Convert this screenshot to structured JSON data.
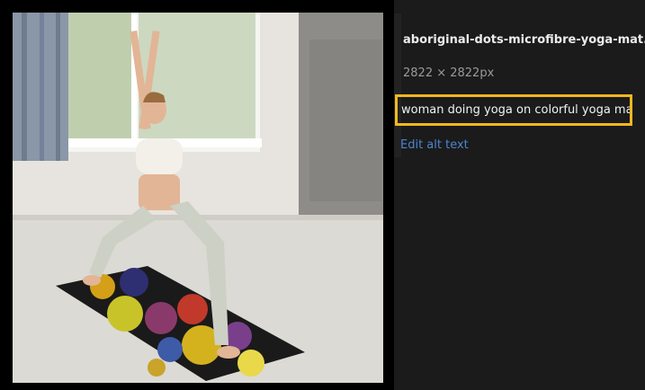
{
  "image": {
    "description_icon": "yoga-photo",
    "filename": "aboriginal-dots-microfibre-yoga-mat.jpg",
    "dimensions": "2822 × 2822px",
    "alt_text": "woman doing yoga on colorful yoga mat",
    "edit_alt_label": "Edit alt text"
  },
  "colors": {
    "highlight": "#f0b820",
    "link": "#4a86d0",
    "panel_bg": "#1b1b1b"
  }
}
